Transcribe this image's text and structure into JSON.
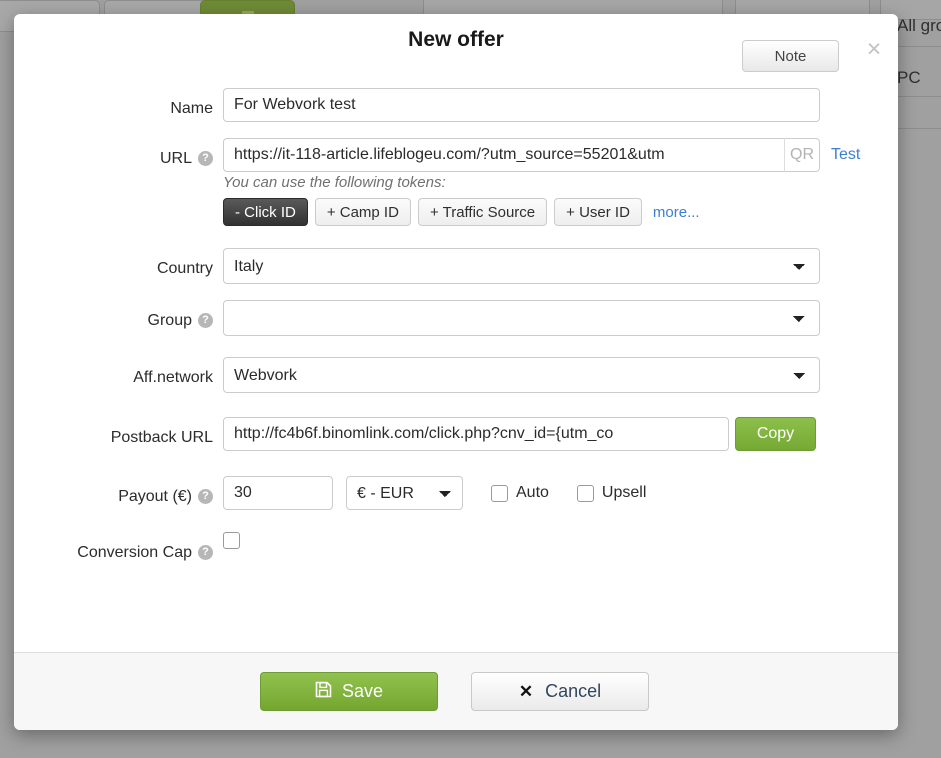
{
  "background": {
    "texts": [
      "All gro",
      "PC"
    ],
    "toolbar_buttons": [
      "trash-button",
      "export-button",
      "add-button"
    ],
    "overlay_color": "#a0a0a0"
  },
  "modal": {
    "title": "New offer",
    "note_label": "Note",
    "close_icon": "close-icon",
    "fields": {
      "name": {
        "label": "Name",
        "value": "For Webvork test",
        "placeholder": ""
      },
      "url": {
        "label": "URL",
        "value": "https://it-118-article.lifeblogeu.com/?utm_source=55201&utm",
        "placeholder": "",
        "qr_label": "QR",
        "test_label": "Test",
        "help_icon": "question-mark-icon"
      },
      "tokens": {
        "hint": "You can use the following tokens:",
        "buttons": [
          {
            "label": "- Click ID",
            "active": true
          },
          {
            "label": "+ Camp ID",
            "active": false
          },
          {
            "label": "+ Traffic Source",
            "active": false
          },
          {
            "label": "+ User ID",
            "active": false
          }
        ],
        "more_label": "more..."
      },
      "country": {
        "label": "Country",
        "value": "Italy",
        "options": [
          "Italy"
        ]
      },
      "group": {
        "label": "Group",
        "value": "",
        "options": [
          ""
        ],
        "help_icon": "question-mark-icon"
      },
      "aff_network": {
        "label": "Aff.network",
        "value": "Webvork",
        "options": [
          "Webvork"
        ]
      },
      "postback_url": {
        "label": "Postback URL",
        "value": "http://fc4b6f.binomlink.com/click.php?cnv_id={utm_co",
        "copy_label": "Copy"
      },
      "payout": {
        "label": "Payout (€)",
        "value": "30",
        "help_icon": "question-mark-icon",
        "currency": "€ - EUR",
        "currency_options": [
          "€ - EUR"
        ],
        "auto_label": "Auto",
        "auto_checked": false,
        "upsell_label": "Upsell",
        "upsell_checked": false
      },
      "conversion_cap": {
        "label": "Conversion Cap",
        "help_icon": "question-mark-icon",
        "checked": false
      }
    },
    "footer": {
      "save_label": "Save",
      "save_icon": "floppy-disk-icon",
      "cancel_label": "Cancel",
      "cancel_icon": "x-icon"
    }
  },
  "colors": {
    "accent_green": "#7fb23e",
    "link_blue": "#3c7fd0",
    "token_active_bg": "#323232"
  }
}
